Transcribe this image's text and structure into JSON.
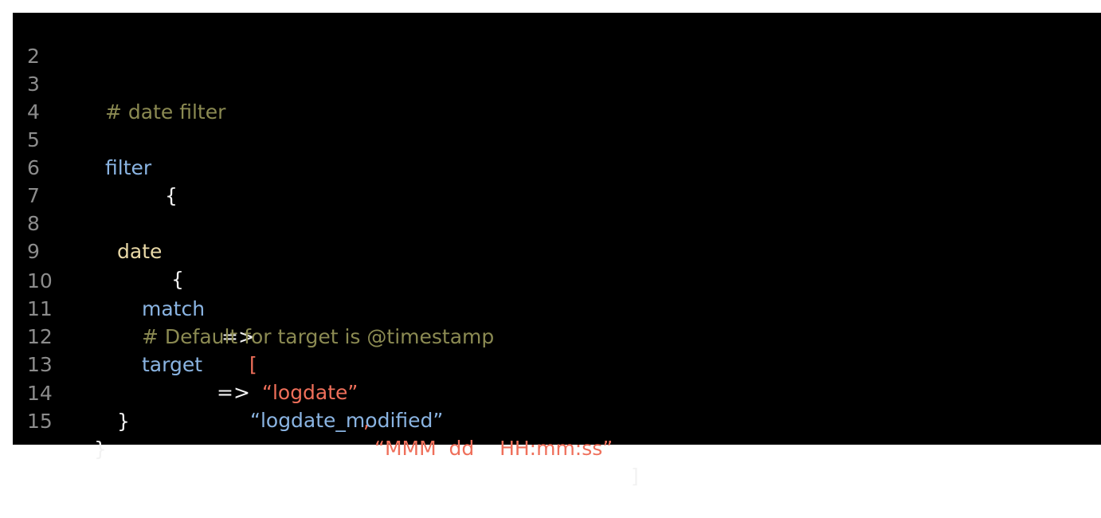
{
  "editor": {
    "lines": [
      {
        "number": "2"
      },
      {
        "number": "3",
        "comment": "# date filter"
      },
      {
        "number": "4"
      },
      {
        "number": "5",
        "keyword": "filter",
        "brace": "{"
      },
      {
        "number": "6"
      },
      {
        "number": "7"
      },
      {
        "number": "8",
        "keyword": "date",
        "brace": "{"
      },
      {
        "number": "9"
      },
      {
        "number": "10",
        "keyword": "match",
        "arrow": "=>",
        "open_bracket": "[",
        "string1": "“logdate”",
        "comma": ",",
        "string2": "“MMM  dd    HH:mm:ss”",
        "close_bracket": "]"
      },
      {
        "number": "11",
        "comment": "# Default for target is @timestamp"
      },
      {
        "number": "12",
        "keyword": "target",
        "arrow": "=>",
        "value": "“logdate_modified”"
      },
      {
        "number": "13"
      },
      {
        "number": "14",
        "brace": "}"
      },
      {
        "number": "15",
        "brace": "}"
      }
    ]
  },
  "colors": {
    "background": "#000000",
    "line_number": "#8c8c8c",
    "comment": "#8b8a52",
    "keyword_blue": "#8ab4e2",
    "keyword_yellow": "#e9d9a7",
    "string": "#ef6f5a",
    "punctuation": "#f2f2f2"
  }
}
